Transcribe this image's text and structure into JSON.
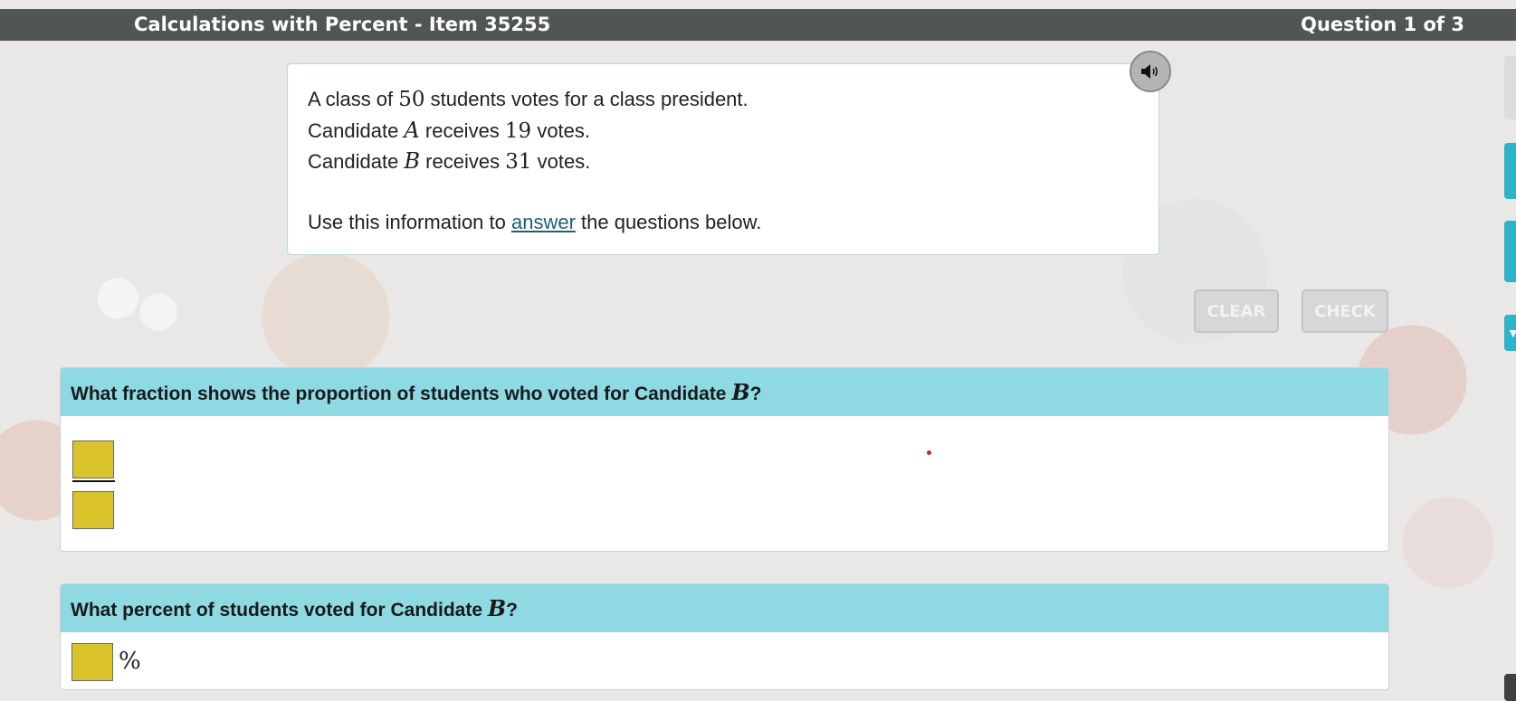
{
  "header": {
    "title": "Calculations with Percent - Item 35255",
    "question_counter": "Question 1 of 3"
  },
  "info": {
    "line1": [
      "A class of ",
      "50",
      " students votes for a class president."
    ],
    "line2": [
      "Candidate ",
      "A",
      " receives ",
      "19",
      " votes."
    ],
    "line3": [
      "Candidate ",
      "B",
      " receives ",
      "31",
      " votes."
    ],
    "line4_before": "Use this information to ",
    "line4_link": "answer",
    "line4_after": " the questions below."
  },
  "audio": {
    "icon": "speaker-icon"
  },
  "buttons": {
    "clear": "CLEAR",
    "check": "CHECK"
  },
  "questions": [
    {
      "prompt": "What fraction shows the proportion of students who voted for Candidate ",
      "variable": "B",
      "suffix": "?",
      "answer_type": "fraction"
    },
    {
      "prompt": "What percent of students voted for Candidate ",
      "variable": "B",
      "suffix": "?",
      "answer_type": "percent",
      "unit": "%"
    }
  ],
  "colors": {
    "topbar": "#515555",
    "question_header": "#8fd9e3",
    "answer_box": "#d9c22a",
    "side_tab_accent": "#2eb4c8",
    "link": "#1f5e78"
  }
}
